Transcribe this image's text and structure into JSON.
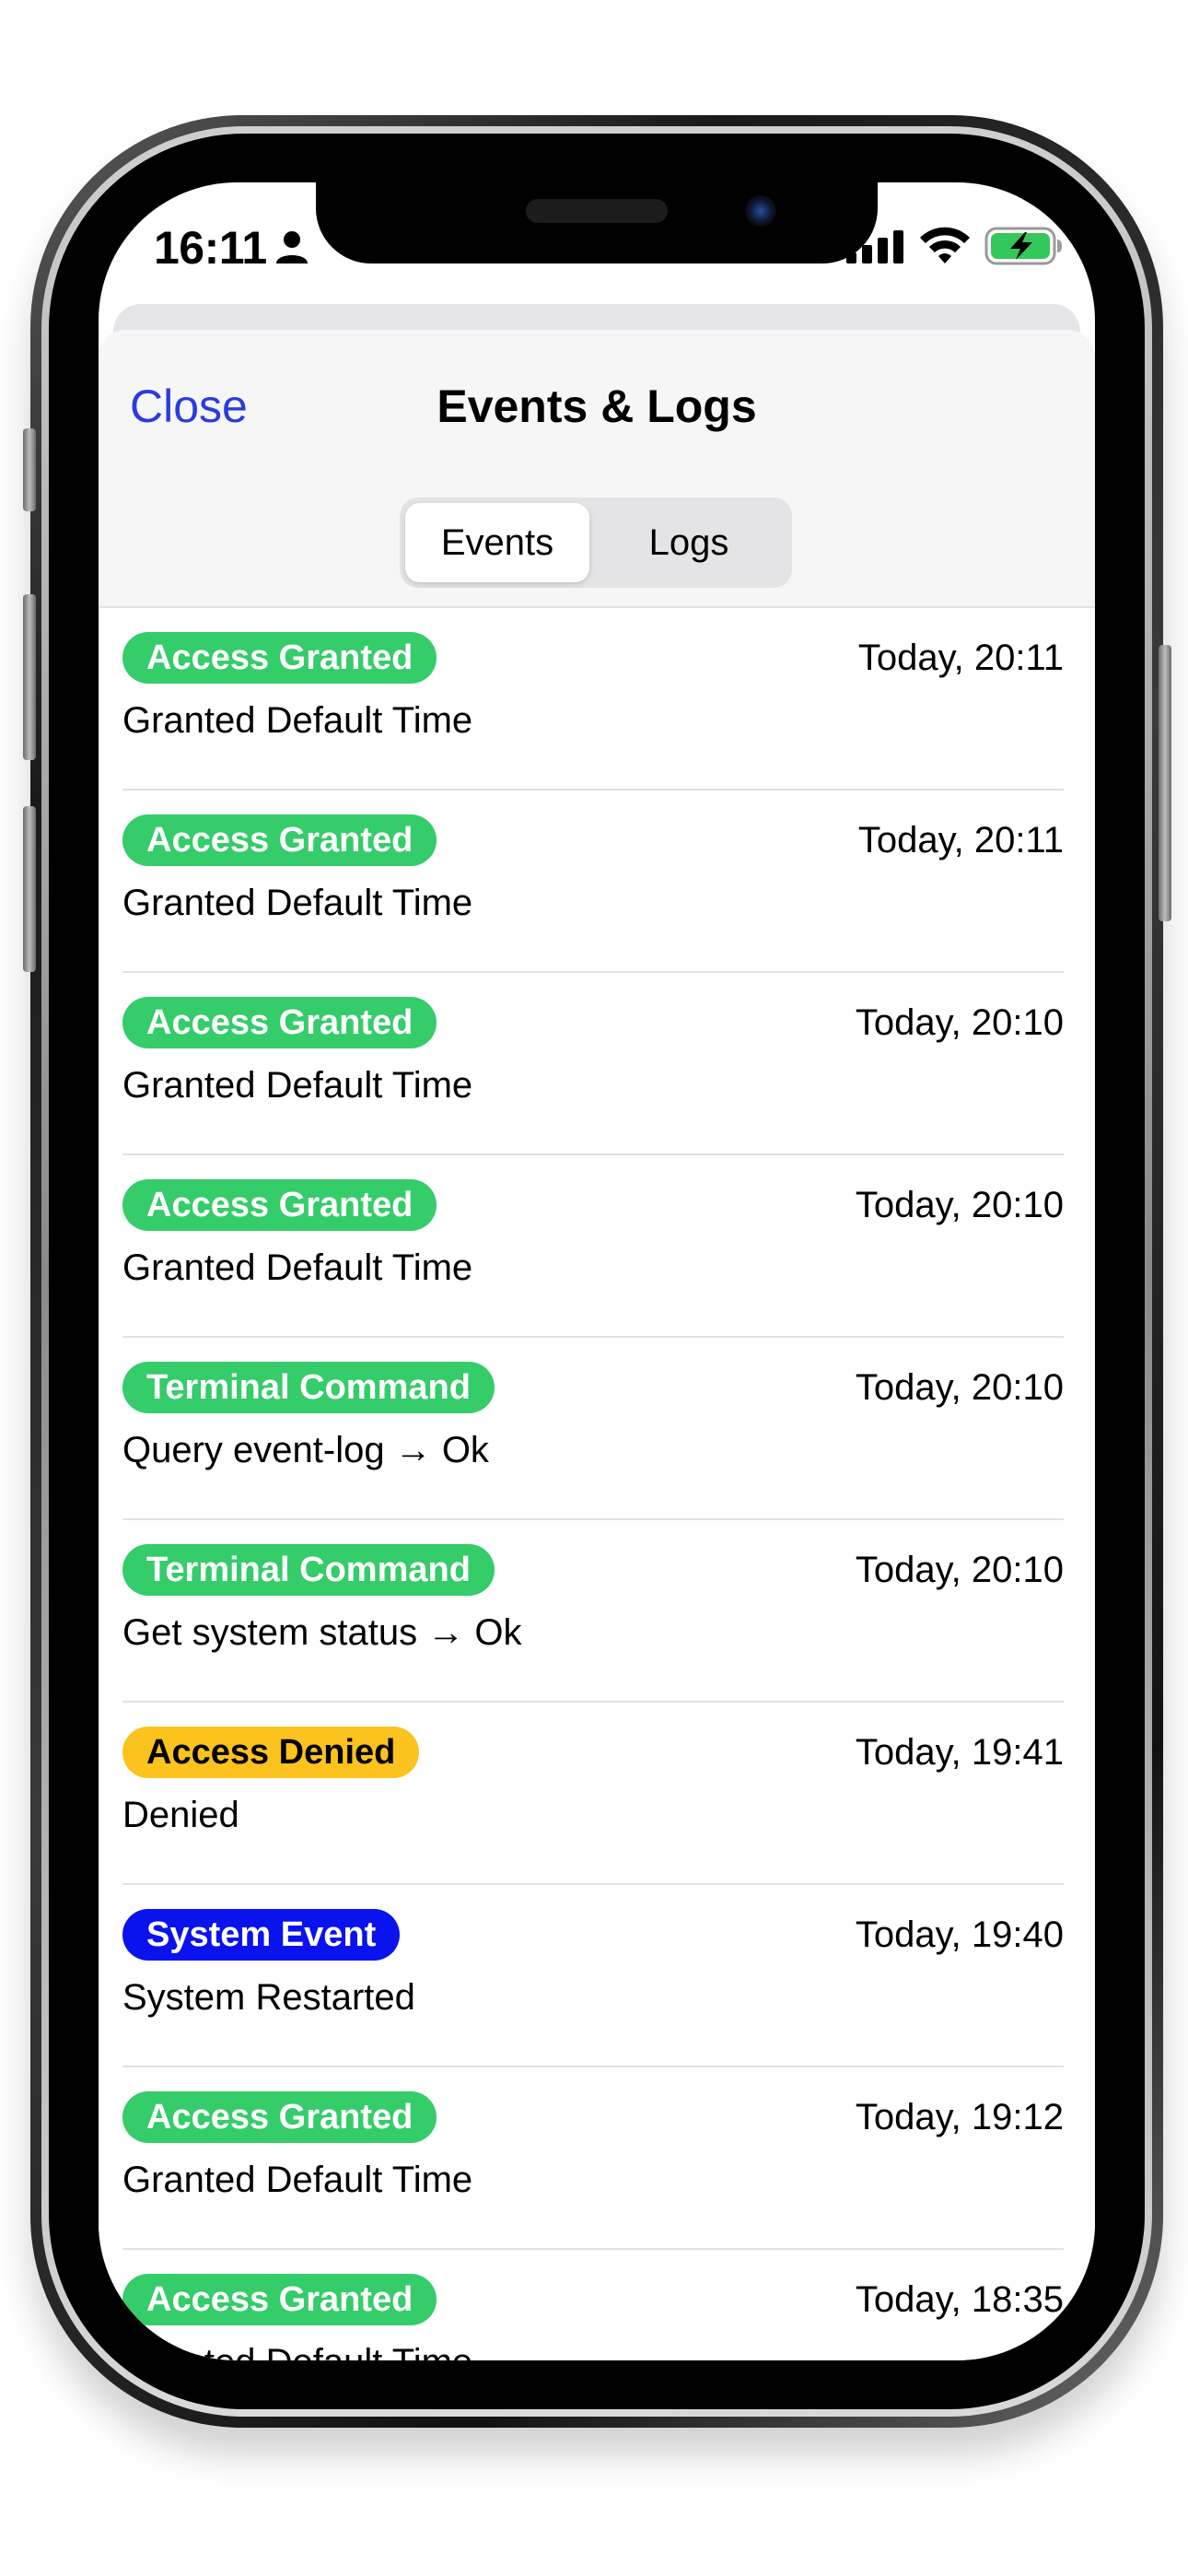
{
  "status_bar": {
    "time": "16:11",
    "icons": [
      "person-icon",
      "cellular-signal-icon",
      "wifi-icon",
      "battery-charging-icon"
    ],
    "battery_color": "#34c759"
  },
  "header": {
    "close_label": "Close",
    "title": "Events & Logs"
  },
  "segmented": {
    "options": [
      "Events",
      "Logs"
    ],
    "selected": "Events"
  },
  "colors": {
    "accent": "#2a3bde",
    "granted": "#35cc6a",
    "denied": "#fcc21e",
    "system": "#0a12ee"
  },
  "events": [
    {
      "type": "Access Granted",
      "time": "Today, 20:11",
      "description": "Granted Default Time"
    },
    {
      "type": "Access Granted",
      "time": "Today, 20:11",
      "description": "Granted Default Time"
    },
    {
      "type": "Access Granted",
      "time": "Today, 20:10",
      "description": "Granted Default Time"
    },
    {
      "type": "Access Granted",
      "time": "Today, 20:10",
      "description": "Granted Default Time"
    },
    {
      "type": "Terminal Command",
      "time": "Today, 20:10",
      "description": "Query event-log → Ok"
    },
    {
      "type": "Terminal Command",
      "time": "Today, 20:10",
      "description": "Get system status → Ok"
    },
    {
      "type": "Access Denied",
      "time": "Today, 19:41",
      "description": "Denied"
    },
    {
      "type": "System Event",
      "time": "Today, 19:40",
      "description": "System Restarted"
    },
    {
      "type": "Access Granted",
      "time": "Today, 19:12",
      "description": "Granted Default Time"
    },
    {
      "type": "Access Granted",
      "time": "Today, 18:35",
      "description": "Granted Default Time"
    }
  ]
}
